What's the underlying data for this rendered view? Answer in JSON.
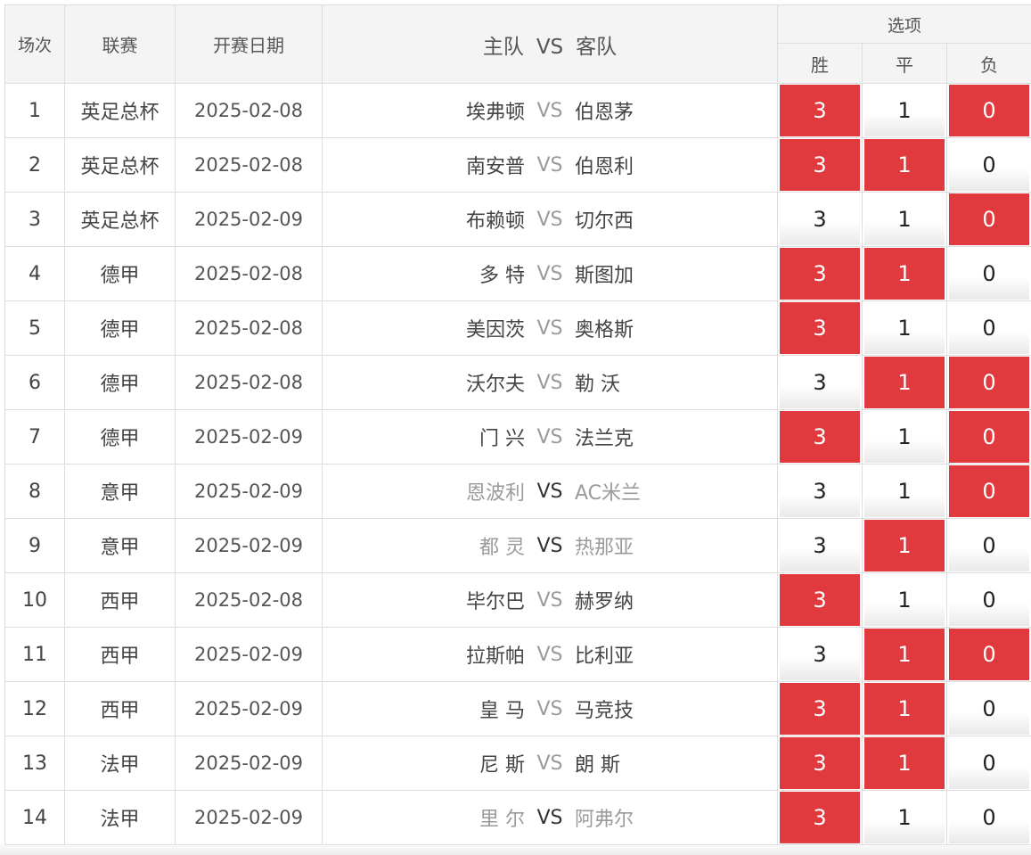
{
  "headers": {
    "round": "场次",
    "league": "联赛",
    "date": "开赛日期",
    "home": "主队",
    "vs": "VS",
    "away": "客队",
    "options": "选项",
    "win": "胜",
    "draw": "平",
    "lose": "负"
  },
  "accent_color": "#e0393e",
  "rows": [
    {
      "no": "1",
      "league": "英足总杯",
      "date": "2025-02-08",
      "home": "埃弗顿",
      "vs": "VS",
      "away": "伯恩茅",
      "w": "3",
      "d": "1",
      "l": "0",
      "sel": [
        true,
        false,
        true
      ],
      "muted": false
    },
    {
      "no": "2",
      "league": "英足总杯",
      "date": "2025-02-08",
      "home": "南安普",
      "vs": "VS",
      "away": "伯恩利",
      "w": "3",
      "d": "1",
      "l": "0",
      "sel": [
        true,
        true,
        false
      ],
      "muted": false
    },
    {
      "no": "3",
      "league": "英足总杯",
      "date": "2025-02-09",
      "home": "布赖顿",
      "vs": "VS",
      "away": "切尔西",
      "w": "3",
      "d": "1",
      "l": "0",
      "sel": [
        false,
        false,
        true
      ],
      "muted": false
    },
    {
      "no": "4",
      "league": "德甲",
      "date": "2025-02-08",
      "home": "多 特",
      "vs": "VS",
      "away": "斯图加",
      "w": "3",
      "d": "1",
      "l": "0",
      "sel": [
        true,
        true,
        false
      ],
      "muted": false
    },
    {
      "no": "5",
      "league": "德甲",
      "date": "2025-02-08",
      "home": "美因茨",
      "vs": "VS",
      "away": "奥格斯",
      "w": "3",
      "d": "1",
      "l": "0",
      "sel": [
        true,
        false,
        false
      ],
      "muted": false
    },
    {
      "no": "6",
      "league": "德甲",
      "date": "2025-02-08",
      "home": "沃尔夫",
      "vs": "VS",
      "away": "勒 沃",
      "w": "3",
      "d": "1",
      "l": "0",
      "sel": [
        false,
        true,
        true
      ],
      "muted": false
    },
    {
      "no": "7",
      "league": "德甲",
      "date": "2025-02-09",
      "home": "门 兴",
      "vs": "VS",
      "away": "法兰克",
      "w": "3",
      "d": "1",
      "l": "0",
      "sel": [
        true,
        false,
        true
      ],
      "muted": false
    },
    {
      "no": "8",
      "league": "意甲",
      "date": "2025-02-09",
      "home": "恩波利",
      "vs": "VS",
      "away": "AC米兰",
      "w": "3",
      "d": "1",
      "l": "0",
      "sel": [
        false,
        false,
        true
      ],
      "muted": true
    },
    {
      "no": "9",
      "league": "意甲",
      "date": "2025-02-09",
      "home": "都 灵",
      "vs": "VS",
      "away": "热那亚",
      "w": "3",
      "d": "1",
      "l": "0",
      "sel": [
        false,
        true,
        false
      ],
      "muted": true
    },
    {
      "no": "10",
      "league": "西甲",
      "date": "2025-02-08",
      "home": "毕尔巴",
      "vs": "VS",
      "away": "赫罗纳",
      "w": "3",
      "d": "1",
      "l": "0",
      "sel": [
        true,
        false,
        false
      ],
      "muted": false
    },
    {
      "no": "11",
      "league": "西甲",
      "date": "2025-02-09",
      "home": "拉斯帕",
      "vs": "VS",
      "away": "比利亚",
      "w": "3",
      "d": "1",
      "l": "0",
      "sel": [
        false,
        true,
        true
      ],
      "muted": false
    },
    {
      "no": "12",
      "league": "西甲",
      "date": "2025-02-09",
      "home": "皇 马",
      "vs": "VS",
      "away": "马竞技",
      "w": "3",
      "d": "1",
      "l": "0",
      "sel": [
        true,
        true,
        false
      ],
      "muted": false
    },
    {
      "no": "13",
      "league": "法甲",
      "date": "2025-02-09",
      "home": "尼 斯",
      "vs": "VS",
      "away": "朗 斯",
      "w": "3",
      "d": "1",
      "l": "0",
      "sel": [
        true,
        true,
        false
      ],
      "muted": false
    },
    {
      "no": "14",
      "league": "法甲",
      "date": "2025-02-09",
      "home": "里 尔",
      "vs": "VS",
      "away": "阿弗尔",
      "w": "3",
      "d": "1",
      "l": "0",
      "sel": [
        true,
        false,
        false
      ],
      "muted": true
    }
  ]
}
